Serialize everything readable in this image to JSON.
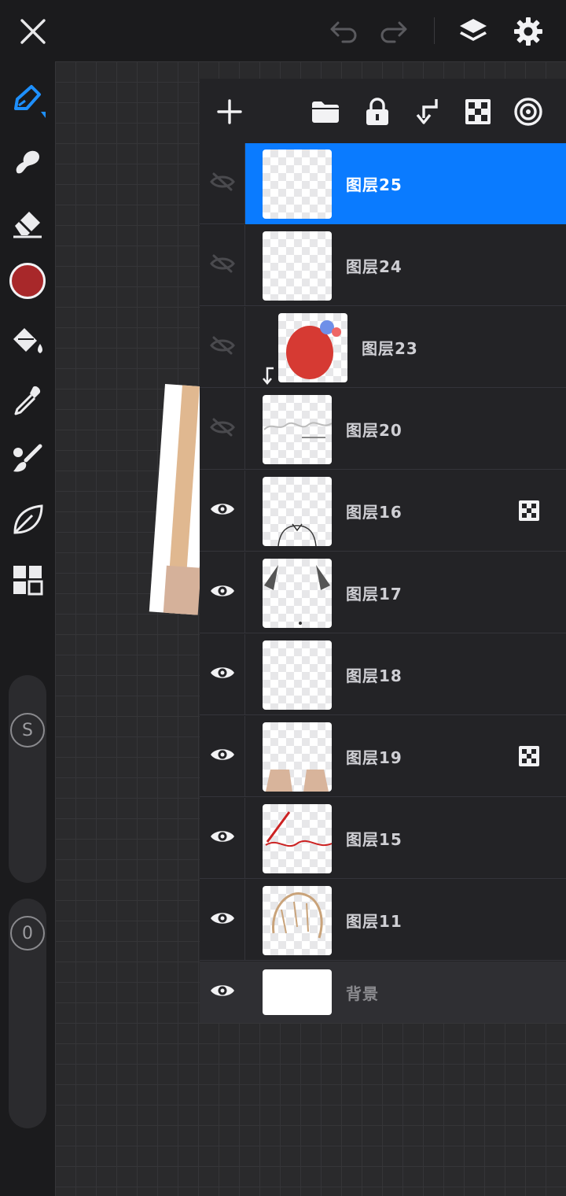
{
  "colors": {
    "accent": "#0a7bff",
    "current_color": "#a8282a"
  },
  "toolbar": {
    "close_icon": "close-icon",
    "undo_icon": "undo-icon",
    "redo_icon": "redo-icon",
    "layers_icon": "layers-icon",
    "settings_icon": "gear-icon"
  },
  "tools": [
    "brush-pen-icon",
    "smudge-icon",
    "eraser-icon",
    "color-swatch",
    "fill-bucket-icon",
    "eyedropper-icon",
    "brush-library-icon",
    "leaf-icon",
    "grid-menu-icon"
  ],
  "sliders": {
    "size_label": "S",
    "opacity_label": "0"
  },
  "layer_panel": {
    "toolbar_icons": [
      "plus-icon",
      "folder-icon",
      "lock-icon",
      "clip-mask-icon",
      "alpha-lock-icon",
      "target-icon"
    ],
    "layers": [
      {
        "name": "图层25",
        "visible": false,
        "selected": true,
        "alpha_lock": false,
        "clipped": false
      },
      {
        "name": "图层24",
        "visible": false,
        "selected": false,
        "alpha_lock": false,
        "clipped": false
      },
      {
        "name": "图层23",
        "visible": false,
        "selected": false,
        "alpha_lock": false,
        "clipped": true
      },
      {
        "name": "图层20",
        "visible": false,
        "selected": false,
        "alpha_lock": false,
        "clipped": false
      },
      {
        "name": "图层16",
        "visible": true,
        "selected": false,
        "alpha_lock": true,
        "clipped": false
      },
      {
        "name": "图层17",
        "visible": true,
        "selected": false,
        "alpha_lock": false,
        "clipped": false
      },
      {
        "name": "图层18",
        "visible": true,
        "selected": false,
        "alpha_lock": false,
        "clipped": false
      },
      {
        "name": "图层19",
        "visible": true,
        "selected": false,
        "alpha_lock": true,
        "clipped": false
      },
      {
        "name": "图层15",
        "visible": true,
        "selected": false,
        "alpha_lock": false,
        "clipped": false
      },
      {
        "name": "图层11",
        "visible": true,
        "selected": false,
        "alpha_lock": false,
        "clipped": false
      }
    ],
    "background_layer": {
      "name": "背景",
      "visible": true
    }
  }
}
